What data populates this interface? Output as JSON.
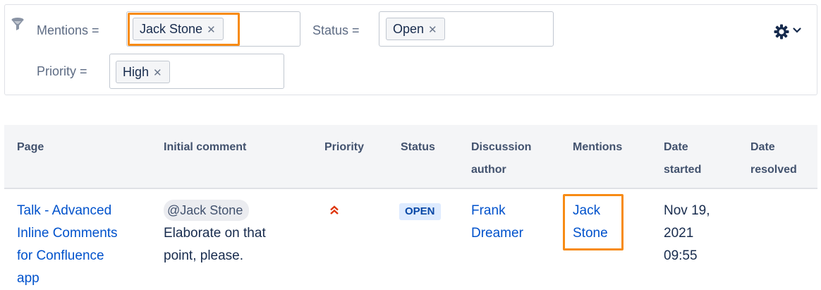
{
  "filters": {
    "mentions": {
      "label": "Mentions =",
      "value": "Jack Stone",
      "remove": "✕"
    },
    "status": {
      "label": "Status =",
      "value": "Open",
      "remove": "✕"
    },
    "priority": {
      "label": "Priority =",
      "value": "High",
      "remove": "✕"
    },
    "icons": {
      "filter": "filter-icon",
      "settings": "gear-icon",
      "dropdown": "chevron-down-icon"
    }
  },
  "table": {
    "headers": {
      "page": "Page",
      "initial_comment": "Initial comment",
      "priority": "Priority",
      "status": "Status",
      "author": [
        "Discussion",
        "author"
      ],
      "mentions": "Mentions",
      "date_started": [
        "Date",
        "started"
      ],
      "date_resolved": [
        "Date",
        "resolved"
      ]
    },
    "rows": [
      {
        "page": [
          "Talk - Advanced",
          "Inline Comments",
          "for Confluence",
          "app"
        ],
        "comment_mention": "@Jack Stone",
        "comment_text": [
          "Elaborate on that",
          "point, please."
        ],
        "priority_icon": "priority-highest-icon",
        "status": "OPEN",
        "author": [
          "Frank",
          "Dreamer"
        ],
        "mentions": [
          "Jack",
          "Stone"
        ],
        "date_started": [
          "Nov 19,",
          "2021",
          "09:55"
        ],
        "date_resolved": ""
      }
    ]
  },
  "colors": {
    "highlight": "#f78b14",
    "link": "#0052cc",
    "priority": "#de350b",
    "lozenge_bg": "#deebff",
    "lozenge_text": "#0747a6"
  }
}
